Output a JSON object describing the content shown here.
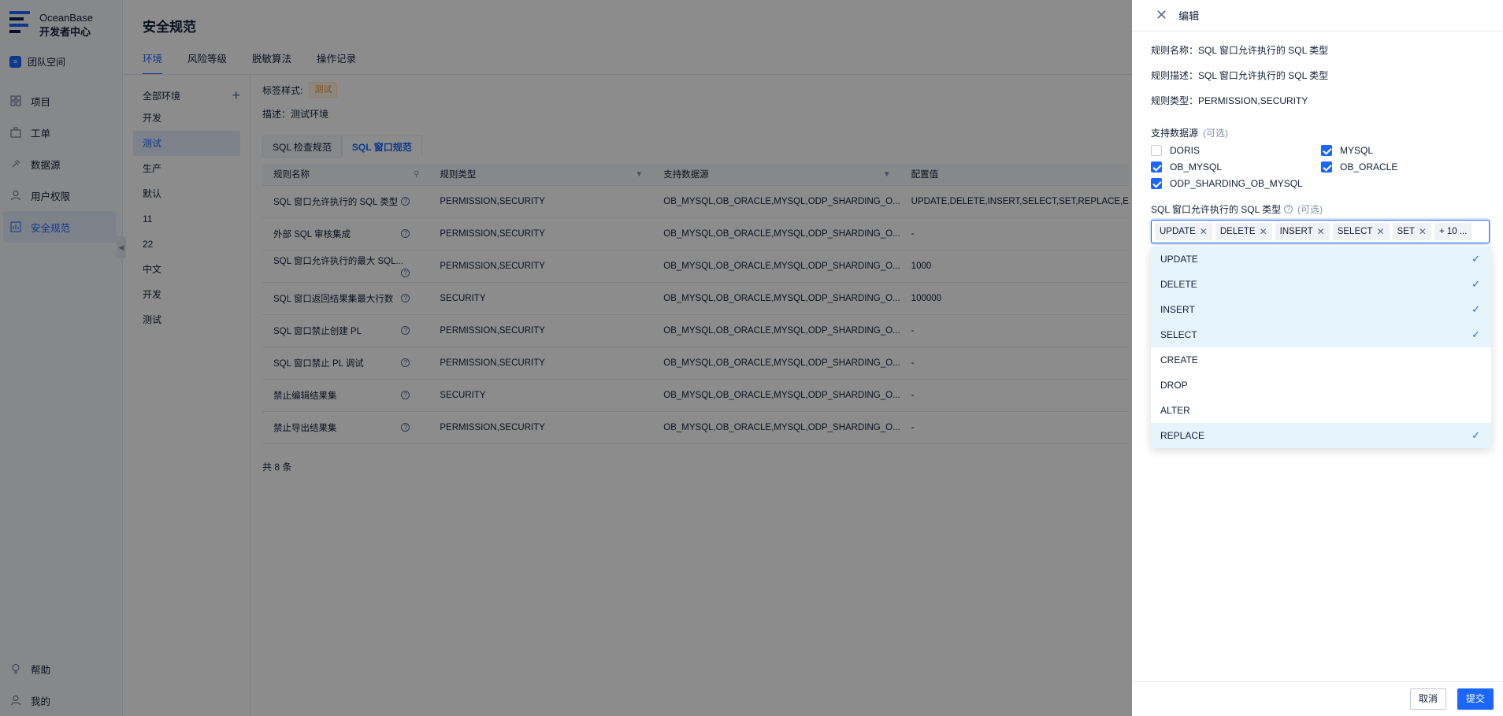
{
  "brand": {
    "name": "OceanBase",
    "subtitle": "开发者中心"
  },
  "team_space": "团队空间",
  "nav": {
    "items": [
      "项目",
      "工单",
      "数据源",
      "用户权限",
      "安全规范"
    ],
    "help": "帮助",
    "me": "我的"
  },
  "page": {
    "title": "安全规范",
    "tabs": [
      "环境",
      "风险等级",
      "脱敏算法",
      "操作记录"
    ]
  },
  "env": {
    "all": "全部环境",
    "items": [
      "开发",
      "测试",
      "生产",
      "默认",
      "11",
      "22",
      "中文",
      "开发",
      "测试"
    ]
  },
  "detail": {
    "tag_label": "标签样式:",
    "tag": "测试",
    "desc": "描述：测试环境"
  },
  "subtabs": [
    "SQL 检查规范",
    "SQL 窗口规范"
  ],
  "table": {
    "headers": [
      "规则名称",
      "规则类型",
      "支持数据源",
      "配置值"
    ],
    "rows": [
      {
        "name": "SQL 窗口允许执行的 SQL 类型",
        "type": "PERMISSION,SECURITY",
        "ds": "OB_MYSQL,OB_ORACLE,MYSQL,ODP_SHARDING_O...",
        "val": "UPDATE,DELETE,INSERT,SELECT,SET,REPLACE,E"
      },
      {
        "name": "外部 SQL 审核集成",
        "type": "PERMISSION,SECURITY",
        "ds": "OB_MYSQL,OB_ORACLE,MYSQL,ODP_SHARDING_O...",
        "val": "-"
      },
      {
        "name": "SQL 窗口允许执行的最大 SQL...",
        "type": "PERMISSION,SECURITY",
        "ds": "OB_MYSQL,OB_ORACLE,MYSQL,ODP_SHARDING_O...",
        "val": "1000"
      },
      {
        "name": "SQL 窗口返回结果集最大行数",
        "type": "SECURITY",
        "ds": "OB_MYSQL,OB_ORACLE,MYSQL,ODP_SHARDING_O...",
        "val": "100000"
      },
      {
        "name": "SQL 窗口禁止创建 PL",
        "type": "PERMISSION,SECURITY",
        "ds": "OB_MYSQL,OB_ORACLE,MYSQL,ODP_SHARDING_O...",
        "val": "-"
      },
      {
        "name": "SQL 窗口禁止 PL 调试",
        "type": "PERMISSION,SECURITY",
        "ds": "OB_MYSQL,OB_ORACLE,MYSQL,ODP_SHARDING_O...",
        "val": "-"
      },
      {
        "name": "禁止编辑结果集",
        "type": "SECURITY",
        "ds": "OB_MYSQL,OB_ORACLE,MYSQL,ODP_SHARDING_O...",
        "val": "-"
      },
      {
        "name": "禁止导出结果集",
        "type": "PERMISSION,SECURITY",
        "ds": "OB_MYSQL,OB_ORACLE,MYSQL,ODP_SHARDING_O...",
        "val": "-"
      }
    ],
    "total": "共 8 条"
  },
  "drawer": {
    "title": "编辑",
    "rule_name": "规则名称：SQL 窗口允许执行的 SQL 类型",
    "rule_desc": "规则描述：SQL 窗口允许执行的 SQL 类型",
    "rule_type": "规则类型：PERMISSION,SECURITY",
    "ds_label": "支持数据源",
    "optional": "(可选)",
    "datasources": [
      {
        "label": "DORIS",
        "checked": false
      },
      {
        "label": "MYSQL",
        "checked": true
      },
      {
        "label": "OB_MYSQL",
        "checked": true
      },
      {
        "label": "OB_ORACLE",
        "checked": true
      },
      {
        "label": "ODP_SHARDING_OB_MYSQL",
        "checked": true
      }
    ],
    "select_label": "SQL 窗口允许执行的 SQL 类型",
    "chips": [
      "UPDATE",
      "DELETE",
      "INSERT",
      "SELECT",
      "SET"
    ],
    "more": "+ 10 ...",
    "options": [
      {
        "label": "UPDATE",
        "selected": true
      },
      {
        "label": "DELETE",
        "selected": true
      },
      {
        "label": "INSERT",
        "selected": true
      },
      {
        "label": "SELECT",
        "selected": true
      },
      {
        "label": "CREATE",
        "selected": false
      },
      {
        "label": "DROP",
        "selected": false
      },
      {
        "label": "ALTER",
        "selected": false
      },
      {
        "label": "REPLACE",
        "selected": true
      }
    ],
    "cancel": "取消",
    "submit": "提交"
  }
}
